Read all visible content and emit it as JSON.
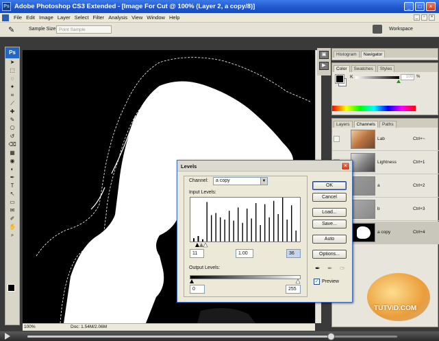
{
  "window": {
    "app_icon": "Ps",
    "title": "Adobe Photoshop CS3 Extended - [Image For Cut @ 100% (Layer 2, a copy/8)]"
  },
  "menu": [
    "File",
    "Edit",
    "Image",
    "Layer",
    "Select",
    "Filter",
    "Analysis",
    "View",
    "Window",
    "Help"
  ],
  "options_bar": {
    "sample_size_label": "Sample Size:",
    "sample_size_value": "Point Sample",
    "workspace_label": "Workspace"
  },
  "toolbox": {
    "logo": "Ps",
    "tools": [
      "move-tool",
      "marquee-tool",
      "lasso-tool",
      "magic-wand-tool",
      "crop-tool",
      "slice-tool",
      "healing-brush-tool",
      "brush-tool",
      "clone-stamp-tool",
      "history-brush-tool",
      "eraser-tool",
      "gradient-tool",
      "blur-tool",
      "dodge-tool",
      "pen-tool",
      "type-tool",
      "path-selection-tool",
      "shape-tool",
      "notes-tool",
      "eyedropper-tool",
      "hand-tool",
      "zoom-tool"
    ],
    "foreground_color": "#000000",
    "background_color": "#ffffff"
  },
  "status_bar": {
    "zoom": "100%",
    "doc": "Doc: 1.54M/2.06M"
  },
  "navigator_panel": {
    "tabs": [
      "Histogram",
      "Navigator"
    ]
  },
  "color_panel": {
    "tabs": [
      "Color",
      "Swatches",
      "Styles"
    ],
    "channel_label": "K",
    "value": "100",
    "unit": "%"
  },
  "layers_panel": {
    "tabs": [
      "Layers",
      "Channels",
      "Paths"
    ],
    "channels": [
      {
        "name": "Lab",
        "shortcut": "Ctrl+~"
      },
      {
        "name": "Lightness",
        "shortcut": "Ctrl+1"
      },
      {
        "name": "a",
        "shortcut": "Ctrl+2"
      },
      {
        "name": "b",
        "shortcut": "Ctrl+3"
      },
      {
        "name": "a copy",
        "shortcut": "Ctrl+4"
      }
    ]
  },
  "levels_dialog": {
    "title": "Levels",
    "channel_label": "Channel:",
    "channel_value": "a copy",
    "input_levels_label": "Input Levels:",
    "input_black": "11",
    "input_gamma": "1.00",
    "input_white": "36",
    "output_levels_label": "Output Levels:",
    "output_black": "0",
    "output_white": "255",
    "buttons": [
      "OK",
      "Cancel",
      "Load...",
      "Save...",
      "Auto",
      "Options..."
    ],
    "preview_label": "Preview",
    "preview_checked": true,
    "histogram_bars": [
      6,
      10,
      4,
      72,
      48,
      52,
      44,
      40,
      56,
      38,
      62,
      34,
      60,
      42,
      70,
      30,
      68,
      44,
      74,
      50,
      80,
      40,
      66,
      20
    ]
  },
  "media": {
    "progress": 0.82
  },
  "watermark": "TUTVID.COM",
  "colors": {
    "titlebar": "#1f56cc",
    "canvas_bg": "#000000",
    "subject": "#ffffff",
    "selected_row": "#c9c6bb"
  }
}
